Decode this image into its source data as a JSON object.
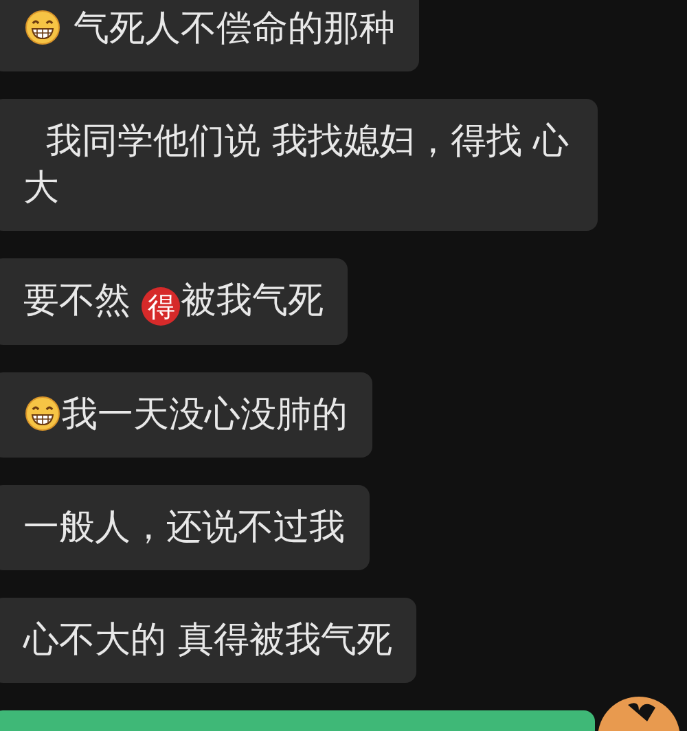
{
  "messages": [
    {
      "kind": "received",
      "parts": [
        {
          "kind": "emoji"
        },
        {
          "kind": "text",
          "text": " 气死人不偿命的那种"
        }
      ]
    },
    {
      "kind": "received",
      "parts": [
        {
          "kind": "text",
          "text": "  我同学他们说 我找媳妇，得找 心大"
        }
      ]
    },
    {
      "kind": "received",
      "parts": [
        {
          "kind": "text",
          "text": "要不然 "
        },
        {
          "kind": "sticker",
          "text": "得"
        },
        {
          "kind": "text",
          "text": "被我气死"
        }
      ]
    },
    {
      "kind": "received",
      "parts": [
        {
          "kind": "emoji"
        },
        {
          "kind": "text",
          "text": "我一天没心没肺的"
        }
      ]
    },
    {
      "kind": "received",
      "parts": [
        {
          "kind": "text",
          "text": "一般人，还说不过我"
        }
      ]
    },
    {
      "kind": "received",
      "parts": [
        {
          "kind": "text",
          "text": "心不大的 真得被我气死"
        }
      ]
    },
    {
      "kind": "sent"
    }
  ]
}
